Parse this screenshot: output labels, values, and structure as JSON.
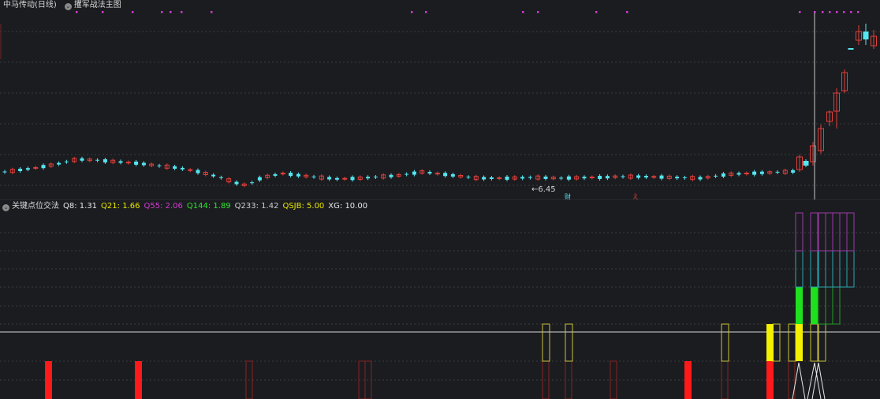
{
  "main_chart": {
    "title": "中马传动(日线)",
    "indicator_name": "攫军战法主图",
    "low_price_label": "←6.45",
    "marker_cai": "财",
    "marker_red": "え",
    "colors": {
      "up": "#e0403a",
      "down": "#55e6f0",
      "dot": "#d23cd2",
      "grid": "#3a3b40",
      "crosshair": "#c8c8c8"
    }
  },
  "sub_chart": {
    "title": "关键点位交法",
    "values": [
      {
        "label": "Q8: 1.31",
        "color": "#e8e8e8"
      },
      {
        "label": "Q21: 1.66",
        "color": "#e8e800"
      },
      {
        "label": "Q55: 2.06",
        "color": "#d23cd2"
      },
      {
        "label": "Q144: 1.89",
        "color": "#2ee62e"
      },
      {
        "label": "Q233: 1.42",
        "color": "#d0d0d0"
      },
      {
        "label": "QSJB: 5.00",
        "color": "#e8e800"
      },
      {
        "label": "XG: 10.00",
        "color": "#e8e8e8"
      }
    ]
  }
}
